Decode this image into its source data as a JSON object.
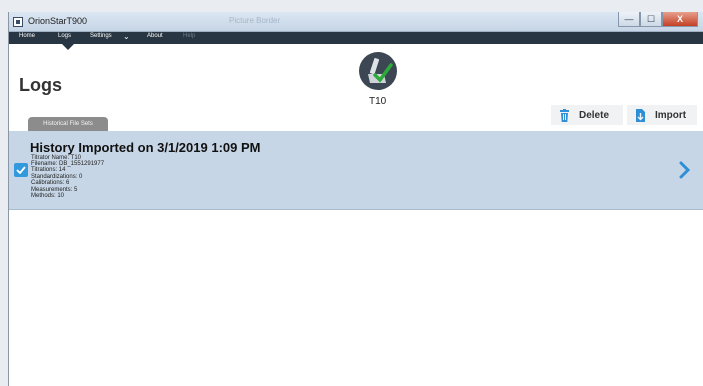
{
  "window": {
    "title": "OrionStarT900",
    "title_ghost": "Picture Border"
  },
  "window_controls": {
    "minimize": "—",
    "maximize": "☐",
    "close": "X"
  },
  "menu": {
    "items": [
      {
        "label": "Home"
      },
      {
        "label": "Logs"
      },
      {
        "label": "Settings"
      },
      {
        "label": "About"
      },
      {
        "label": "Help"
      }
    ],
    "chevron": "⌄"
  },
  "page": {
    "title": "Logs"
  },
  "device": {
    "name": "T10",
    "status": "connected"
  },
  "actions": {
    "delete_label": "Delete",
    "import_label": "Import"
  },
  "tab": {
    "label": "Historical File Sets"
  },
  "history_entry": {
    "checked": true,
    "title": "History Imported on 3/1/2019 1:09 PM",
    "details": [
      "Titrator Name: T10",
      "Filename: DB_1551291977",
      "Titrations: 14",
      "Standardizations: 0",
      "Calibrations: 6",
      "Measurements: 5",
      "Methods: 10"
    ]
  },
  "colors": {
    "accent": "#3399dd",
    "menubar": "#283542",
    "row": "#c6d6e6"
  }
}
